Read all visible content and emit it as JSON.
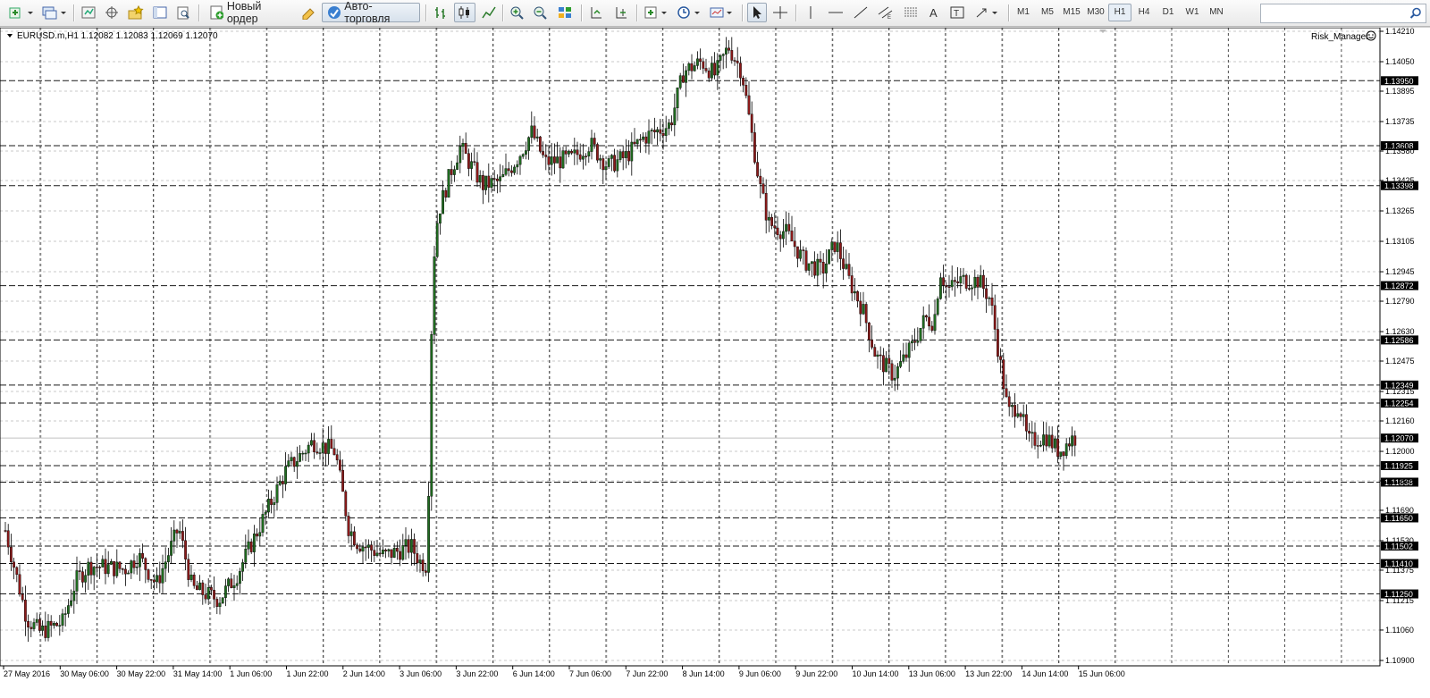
{
  "toolbar": {
    "new_order_label": "Новый ордер",
    "algo_trading_label": "Авто-торговля",
    "timeframes": [
      "M1",
      "M5",
      "M15",
      "M30",
      "H1",
      "H4",
      "D1",
      "W1",
      "MN"
    ],
    "active_timeframe": "H1",
    "search_value": ""
  },
  "chart": {
    "symbol_info": "EURUSD.m,H1  1.12082 1.12083 1.12069 1.12070",
    "expert_label": "Risk_Manager",
    "bull_color": "#1f6b1f",
    "bear_color": "#8b1a1a",
    "grid_color": "#c8c8c8",
    "level_color": "#1a1a1a"
  },
  "chart_data": {
    "type": "candlestick",
    "symbol": "EURUSD.m",
    "timeframe": "H1",
    "last_bar": {
      "open": 1.12082,
      "high": 1.12083,
      "low": 1.12069,
      "close": 1.1207
    },
    "price_ticks": [
      "1.14210",
      "1.14050",
      "1.13895",
      "1.13735",
      "1.13580",
      "1.13425",
      "1.13265",
      "1.13105",
      "1.12945",
      "1.12790",
      "1.12630",
      "1.12475",
      "1.12315",
      "1.12160",
      "1.12000",
      "1.11845",
      "1.11690",
      "1.11530",
      "1.11375",
      "1.11215",
      "1.11060",
      "1.10900"
    ],
    "levels": [
      "1.13950",
      "1.13608",
      "1.13398",
      "1.12872",
      "1.12586",
      "1.12349",
      "1.12254",
      "1.11925",
      "1.11838",
      "1.11650",
      "1.11502",
      "1.11410",
      "1.11250"
    ],
    "current_price": "1.12070",
    "time_labels": [
      "27 May 2016",
      "30 May 06:00",
      "30 May 22:00",
      "31 May 14:00",
      "1 Jun 06:00",
      "1 Jun 22:00",
      "2 Jun 14:00",
      "3 Jun 06:00",
      "3 Jun 22:00",
      "6 Jun 14:00",
      "7 Jun 06:00",
      "7 Jun 22:00",
      "8 Jun 14:00",
      "9 Jun 06:00",
      "9 Jun 22:00",
      "10 Jun 14:00",
      "13 Jun 06:00",
      "13 Jun 22:00",
      "14 Jun 14:00",
      "15 Jun 06:00"
    ],
    "ylim": [
      1.109,
      1.1421
    ],
    "close_path": [
      {
        "x": 0,
        "close": 1.117
      },
      {
        "x": 30,
        "close": 1.1112
      },
      {
        "x": 45,
        "close": 1.1105
      },
      {
        "x": 70,
        "close": 1.111
      },
      {
        "x": 85,
        "close": 1.1132
      },
      {
        "x": 100,
        "close": 1.114
      },
      {
        "x": 140,
        "close": 1.1138
      },
      {
        "x": 155,
        "close": 1.1145
      },
      {
        "x": 175,
        "close": 1.113
      },
      {
        "x": 200,
        "close": 1.116
      },
      {
        "x": 215,
        "close": 1.1128
      },
      {
        "x": 245,
        "close": 1.1122
      },
      {
        "x": 265,
        "close": 1.1135
      },
      {
        "x": 290,
        "close": 1.116
      },
      {
        "x": 320,
        "close": 1.119
      },
      {
        "x": 350,
        "close": 1.1205
      },
      {
        "x": 375,
        "close": 1.12
      },
      {
        "x": 390,
        "close": 1.116
      },
      {
        "x": 400,
        "close": 1.1152
      },
      {
        "x": 430,
        "close": 1.1145
      },
      {
        "x": 460,
        "close": 1.115
      },
      {
        "x": 470,
        "close": 1.1142
      },
      {
        "x": 478,
        "close": 1.114
      },
      {
        "x": 484,
        "close": 1.1295
      },
      {
        "x": 490,
        "close": 1.1325
      },
      {
        "x": 505,
        "close": 1.1348
      },
      {
        "x": 515,
        "close": 1.136
      },
      {
        "x": 540,
        "close": 1.134
      },
      {
        "x": 560,
        "close": 1.1342
      },
      {
        "x": 580,
        "close": 1.1355
      },
      {
        "x": 595,
        "close": 1.1368
      },
      {
        "x": 610,
        "close": 1.1352
      },
      {
        "x": 640,
        "close": 1.1354
      },
      {
        "x": 660,
        "close": 1.1362
      },
      {
        "x": 680,
        "close": 1.135
      },
      {
        "x": 700,
        "close": 1.1355
      },
      {
        "x": 720,
        "close": 1.1365
      },
      {
        "x": 750,
        "close": 1.1372
      },
      {
        "x": 765,
        "close": 1.14
      },
      {
        "x": 785,
        "close": 1.1405
      },
      {
        "x": 800,
        "close": 1.1398
      },
      {
        "x": 815,
        "close": 1.1413
      },
      {
        "x": 830,
        "close": 1.14
      },
      {
        "x": 840,
        "close": 1.137
      },
      {
        "x": 850,
        "close": 1.134
      },
      {
        "x": 860,
        "close": 1.132
      },
      {
        "x": 880,
        "close": 1.1315
      },
      {
        "x": 900,
        "close": 1.13
      },
      {
        "x": 920,
        "close": 1.1295
      },
      {
        "x": 935,
        "close": 1.131
      },
      {
        "x": 950,
        "close": 1.129
      },
      {
        "x": 965,
        "close": 1.1275
      },
      {
        "x": 980,
        "close": 1.125
      },
      {
        "x": 1000,
        "close": 1.124
      },
      {
        "x": 1020,
        "close": 1.1255
      },
      {
        "x": 1035,
        "close": 1.127
      },
      {
        "x": 1045,
        "close": 1.1268
      },
      {
        "x": 1052,
        "close": 1.1295
      },
      {
        "x": 1060,
        "close": 1.1285
      },
      {
        "x": 1075,
        "close": 1.129
      },
      {
        "x": 1095,
        "close": 1.129
      },
      {
        "x": 1108,
        "close": 1.128
      },
      {
        "x": 1118,
        "close": 1.125
      },
      {
        "x": 1128,
        "close": 1.122
      },
      {
        "x": 1140,
        "close": 1.1225
      },
      {
        "x": 1150,
        "close": 1.1205
      },
      {
        "x": 1170,
        "close": 1.1208
      },
      {
        "x": 1185,
        "close": 1.12
      },
      {
        "x": 1200,
        "close": 1.1207
      }
    ]
  }
}
